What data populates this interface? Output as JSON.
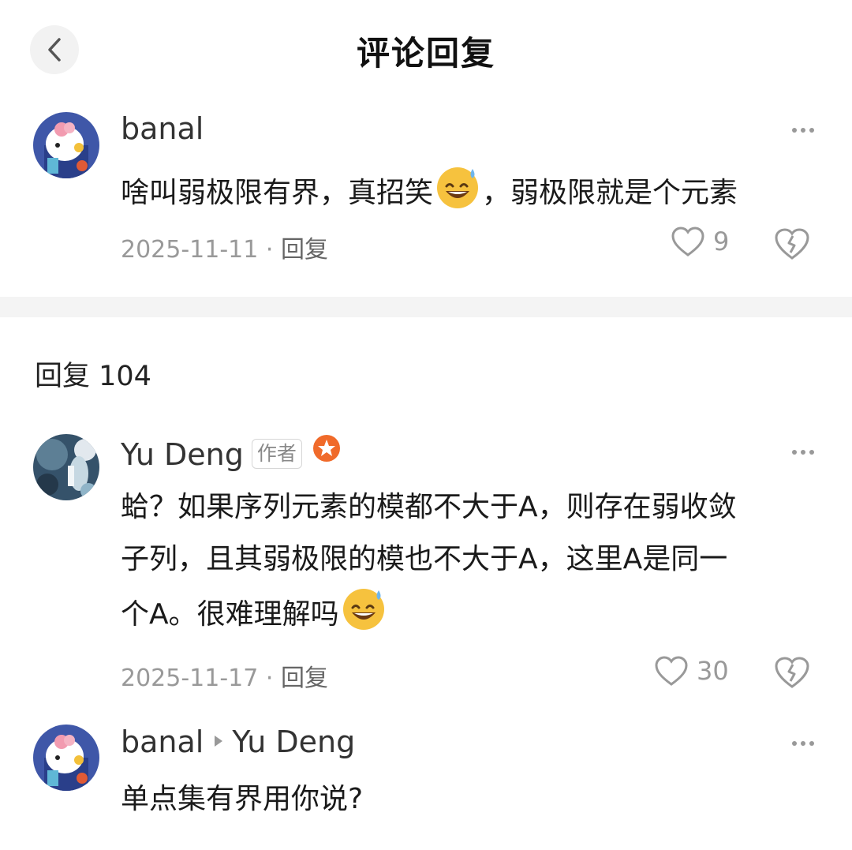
{
  "header": {
    "title": "评论回复"
  },
  "main_comment": {
    "user": "banal",
    "text_before": "啥叫弱极限有界，真招笑",
    "text_after": "，弱极限就是个元素",
    "date": "2025-11-11",
    "separator": " · ",
    "reply_label": "回复",
    "likes": "9"
  },
  "replies": {
    "header": "回复 104",
    "items": [
      {
        "user": "Yu Deng",
        "badge": "作者",
        "text_line1": "蛤？如果序列元素的模都不大于A，则存在弱收敛",
        "text_line2": "子列，且其弱极限的模也不大于A，这里A是同一",
        "text_line3": "个A。很难理解吗",
        "date": "2025-11-17",
        "separator": " · ",
        "reply_label": "回复",
        "likes": "30"
      },
      {
        "user": "banal",
        "reply_to": "Yu Deng",
        "text": "单点集有界用你说?"
      }
    ]
  },
  "icons": {
    "back": "chevron-left-icon",
    "more": "more-dots-icon",
    "like": "heart-outline-icon",
    "dislike": "broken-heart-icon",
    "emoji": "sweat-smile-emoji",
    "verified": "orange-star-badge-icon"
  },
  "colors": {
    "accent_badge": "#f06a2a",
    "meta_gray": "#999999"
  }
}
